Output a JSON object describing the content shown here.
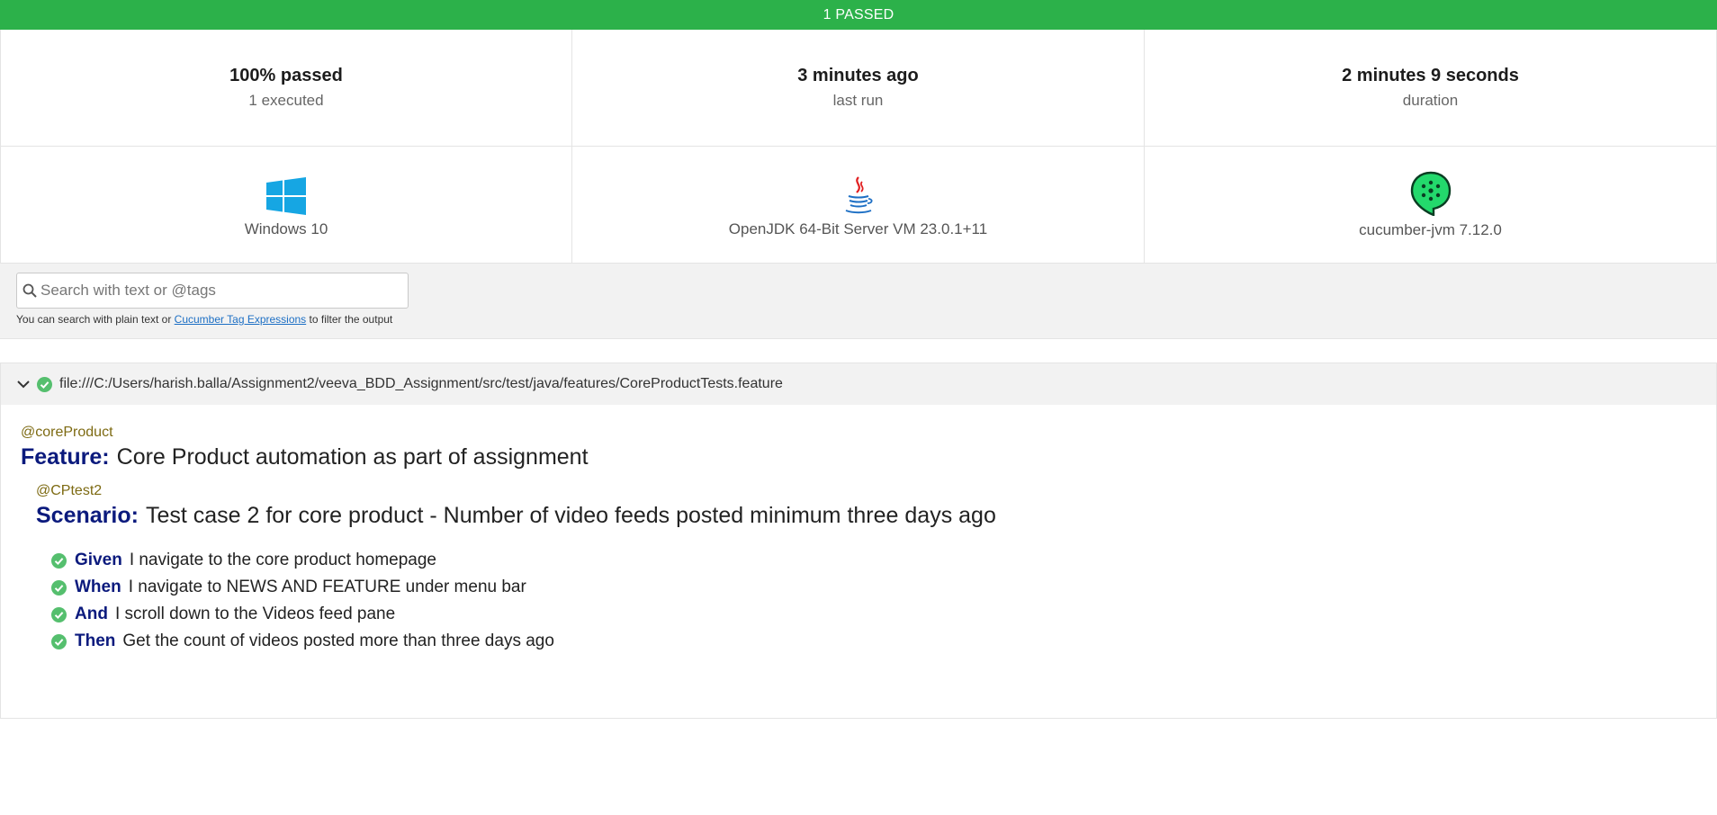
{
  "banner": {
    "text": "1 PASSED",
    "color": "#2cb14a"
  },
  "stats": [
    {
      "big": "100% passed",
      "small": "1 executed"
    },
    {
      "big": "3 minutes ago",
      "small": "last run"
    },
    {
      "big": "2 minutes 9 seconds",
      "small": "duration"
    }
  ],
  "env": {
    "os": {
      "label": "Windows 10",
      "icon": "windows-icon"
    },
    "runtime": {
      "label": "OpenJDK 64-Bit Server VM 23.0.1+11",
      "icon": "java-icon"
    },
    "implementation": {
      "label": "cucumber-jvm 7.12.0",
      "icon": "cucumber-icon"
    }
  },
  "search": {
    "placeholder": "Search with text or @tags",
    "help_before": "You can search with plain text or ",
    "help_link": "Cucumber Tag Expressions",
    "help_after": " to filter the output"
  },
  "feature": {
    "path": "file:///C:/Users/harish.balla/Assignment2/veeva_BDD_Assignment/src/test/java/features/CoreProductTests.feature",
    "tag": "@coreProduct",
    "keyword": "Feature:",
    "name": "Core Product automation as part of assignment",
    "scenario": {
      "tag": "@CPtest2",
      "keyword": "Scenario:",
      "name": "Test case 2 for core product - Number of video feeds posted minimum three days ago",
      "steps": [
        {
          "keyword": "Given",
          "text": "I navigate to the core product homepage"
        },
        {
          "keyword": "When",
          "text": "I navigate to NEWS AND FEATURE under menu bar"
        },
        {
          "keyword": "And",
          "text": "I scroll down to the Videos feed pane"
        },
        {
          "keyword": "Then",
          "text": "Get the count of videos posted more than three days ago"
        }
      ]
    }
  }
}
